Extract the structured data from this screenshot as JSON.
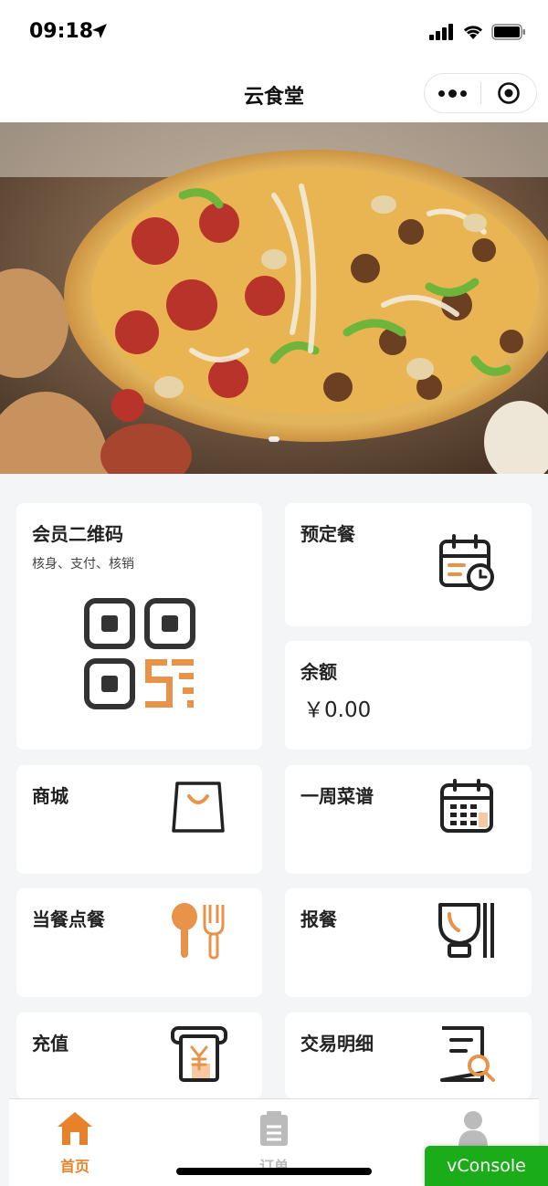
{
  "status_bar": {
    "time": "09:18"
  },
  "nav": {
    "title": "云食堂"
  },
  "cards": {
    "member_qr": {
      "title": "会员二维码",
      "subtitle": "核身、支付、核销"
    },
    "reserve": {
      "title": "预定餐"
    },
    "balance": {
      "title": "余额",
      "value": "￥0.00"
    },
    "mall": {
      "title": "商城"
    },
    "weekly_menu": {
      "title": "一周菜谱"
    },
    "order_now": {
      "title": "当餐点餐"
    },
    "report_meal": {
      "title": "报餐"
    },
    "recharge": {
      "title": "充值"
    },
    "transactions": {
      "title": "交易明细"
    }
  },
  "tabs": [
    {
      "label": "首页",
      "active": true
    },
    {
      "label": "订单",
      "active": false
    },
    {
      "label": "",
      "active": false
    }
  ],
  "vconsole": {
    "label": "vConsole"
  },
  "colors": {
    "accent": "#e8934a",
    "tab_active": "#e8822a",
    "vconsole": "#1aad19"
  }
}
